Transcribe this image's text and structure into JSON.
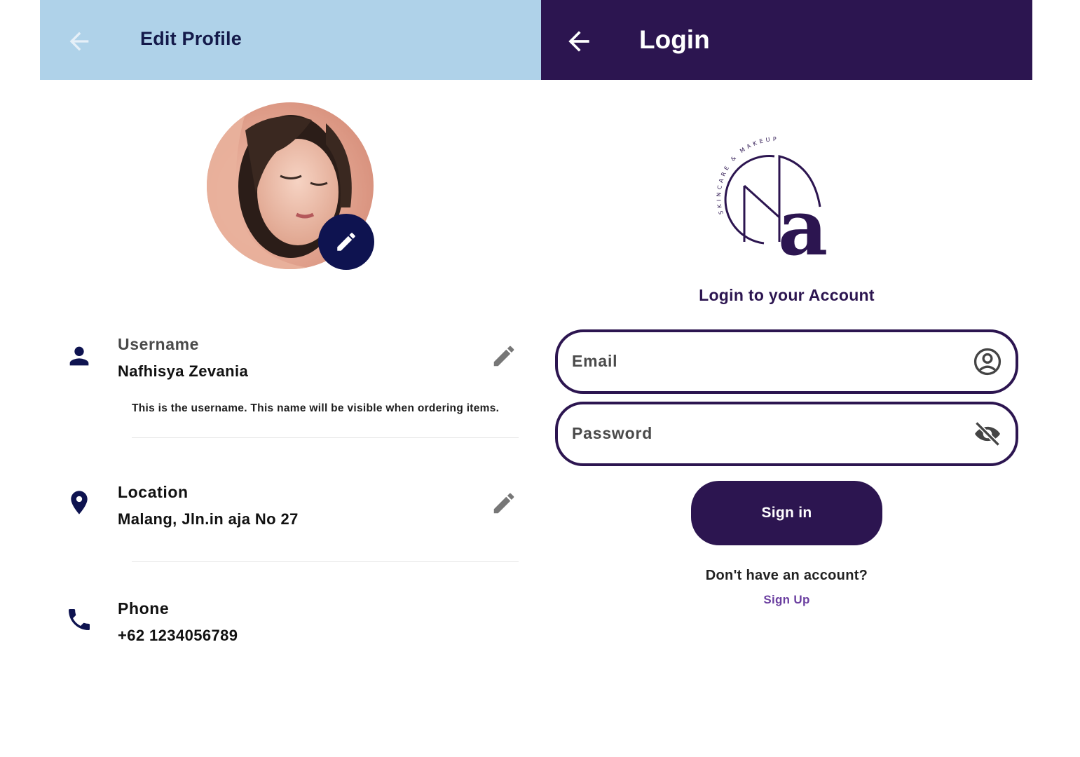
{
  "colors": {
    "profile_bar": "#afd2e9",
    "profile_accent": "#0e1350",
    "login_bar": "#2c1550",
    "link": "#6b3fa0"
  },
  "profile": {
    "title": "Edit Profile",
    "back_icon": "arrow-back-icon",
    "avatar_edit_icon": "pencil-icon",
    "fields": [
      {
        "icon": "person-icon",
        "label": "Username",
        "value": "Nafhisya Zevania",
        "hint": "This is the username. This name will be visible when ordering items.",
        "editable": true
      },
      {
        "icon": "location-pin-icon",
        "label": "Location",
        "value": "Malang, Jln.in aja No 27",
        "editable": true
      },
      {
        "icon": "phone-icon",
        "label": "Phone",
        "value": "+62 1234056789",
        "editable": false
      }
    ]
  },
  "login": {
    "title": "Login",
    "back_icon": "arrow-back-icon",
    "logo": {
      "monogram": "Na",
      "ring_text": "SKINCARE & MAKEUP"
    },
    "heading": "Login to your Account",
    "email_placeholder": "Email",
    "email_icon": "account-circle-icon",
    "password_placeholder": "Password",
    "password_icon": "eye-off-icon",
    "signin_label": "Sign in",
    "no_account_text": "Don't have an account?",
    "signup_label": "Sign Up"
  }
}
